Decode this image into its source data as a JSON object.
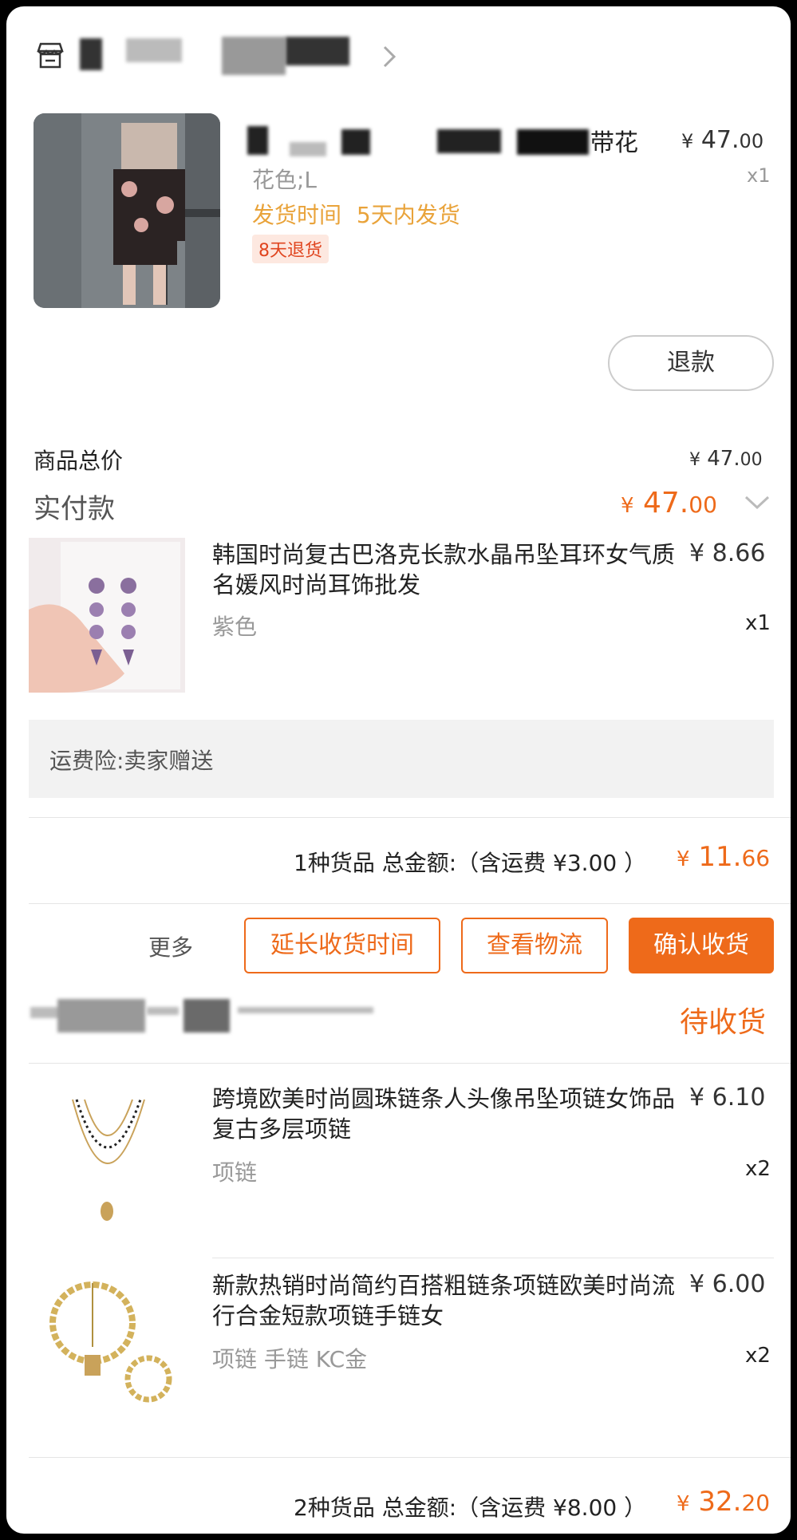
{
  "shop1": {
    "icon": "store-icon",
    "chevron": "chevron-right-icon"
  },
  "item1": {
    "title_visible": "带花",
    "price_symbol": "¥",
    "price_int": "47.",
    "price_dec": "00",
    "variant": "花色;L",
    "qty": "x1",
    "ship_label": "发货时间",
    "ship_value": "5天内发货",
    "return_badge": "8天退货",
    "refund_button": "退款"
  },
  "summary1": {
    "subtotal_label": "商品总价",
    "subtotal_symbol": "¥",
    "subtotal_int": "47.",
    "subtotal_dec": "00",
    "paid_label": "实付款",
    "paid_symbol": "¥",
    "paid_int": "47.",
    "paid_dec": "00"
  },
  "item2": {
    "title": "韩国时尚复古巴洛克长款水晶吊坠耳环女气质名媛风时尚耳饰批发",
    "price": "¥ 8.66",
    "variant": "紫色",
    "qty": "x1"
  },
  "insurance": {
    "text": "运费险:卖家赠送"
  },
  "order2_total": {
    "label": "1种货品 总金额:（含运费 ¥3.00 ）",
    "symbol": "¥",
    "int": "11.",
    "dec": "66"
  },
  "actions": {
    "more": "更多",
    "extend": "延长收货时间",
    "logistics": "查看物流",
    "confirm": "确认收货"
  },
  "shop3": {
    "status": "待收货"
  },
  "item3": {
    "title": "跨境欧美时尚圆珠链条人头像吊坠项链女饰品复古多层项链",
    "price": "¥ 6.10",
    "variant": "项链",
    "qty": "x2"
  },
  "item4": {
    "title": "新款热销时尚简约百搭粗链条项链欧美时尚流行合金短款项链手链女",
    "price": "¥ 6.00",
    "variant": "项链 手链 KC金",
    "qty": "x2"
  },
  "order3_total": {
    "label": "2种货品 总金额:（含运费 ¥8.00 ）",
    "symbol": "¥",
    "int": "32.",
    "dec": "20"
  },
  "colors": {
    "accent": "#ee6a1a",
    "muted": "#999999",
    "ship": "#e9a33a"
  }
}
